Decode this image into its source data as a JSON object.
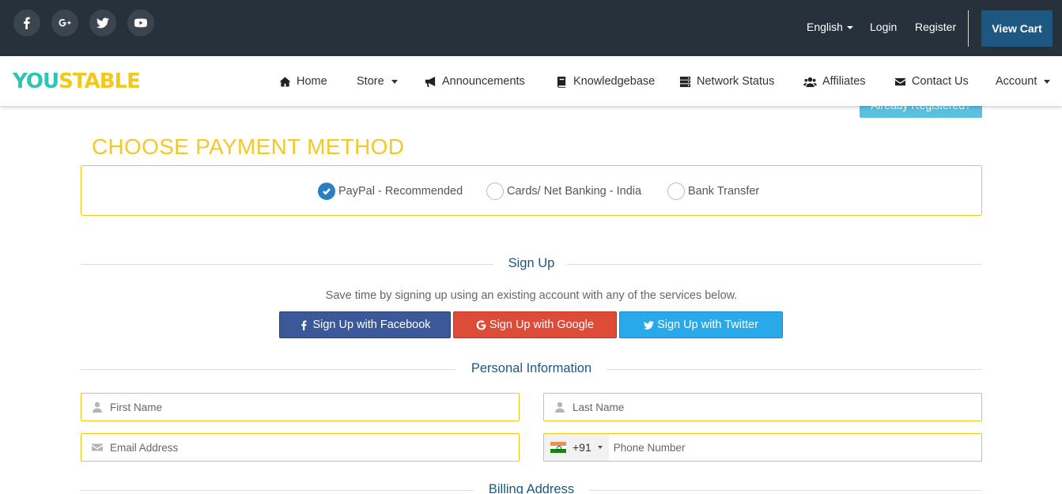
{
  "social": [
    {
      "icon": "facebook-icon"
    },
    {
      "icon": "google-plus-icon"
    },
    {
      "icon": "twitter-icon"
    },
    {
      "icon": "youtube-icon"
    }
  ],
  "topbar": {
    "language": "English",
    "login": "Login",
    "register": "Register",
    "view_cart": "View Cart"
  },
  "logo": {
    "part1": "YOU",
    "part2": "STABLE"
  },
  "nav": {
    "home": "Home",
    "store": "Store",
    "announcements": "Announcements",
    "knowledgebase": "Knowledgebase",
    "network_status": "Network Status",
    "affiliates": "Affiliates",
    "contact_us": "Contact Us",
    "account": "Account"
  },
  "already_registered": "Already Registered?",
  "payment": {
    "title": "CHOOSE PAYMENT METHOD",
    "options": [
      {
        "label": "PayPal - Recommended",
        "selected": true
      },
      {
        "label": "Cards/ Net Banking - India",
        "selected": false
      },
      {
        "label": "Bank Transfer",
        "selected": false
      }
    ]
  },
  "signup": {
    "heading": "Sign Up",
    "description": "Save time by signing up using an existing account with any of the services below.",
    "facebook": "Sign Up with Facebook",
    "google": "Sign Up with Google",
    "twitter": "Sign Up with Twitter"
  },
  "personal": {
    "heading": "Personal Information",
    "first_name_placeholder": "First Name",
    "last_name_placeholder": "Last Name",
    "email_placeholder": "Email Address",
    "country_code": "+91",
    "phone_placeholder": "Phone Number"
  },
  "billing": {
    "heading": "Billing Address"
  },
  "colors": {
    "topbar_bg": "#27313b",
    "view_cart_bg": "#1d5782",
    "accent_yellow": "#f3c829",
    "heading_blue": "#1d5782",
    "facebook": "#3b5998",
    "google": "#dd4b39",
    "twitter": "#29a9ea"
  }
}
